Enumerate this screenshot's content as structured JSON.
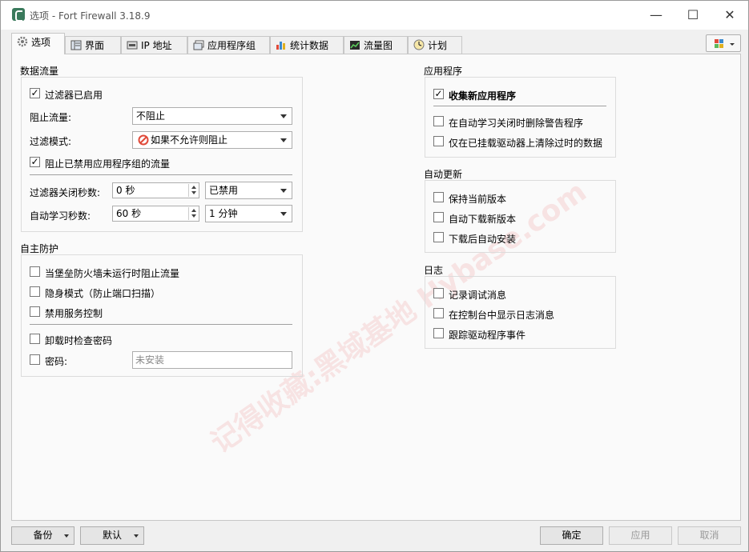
{
  "window": {
    "title": "选项 - Fort Firewall 3.18.9",
    "minimize": "—",
    "maximize": "☐",
    "close": "✕"
  },
  "tabs": [
    {
      "label": "选项",
      "icon": "gear-icon"
    },
    {
      "label": "界面",
      "icon": "interface-icon"
    },
    {
      "label": "IP 地址",
      "icon": "ip-address-icon"
    },
    {
      "label": "应用程序组",
      "icon": "app-group-icon"
    },
    {
      "label": "统计数据",
      "icon": "statistics-icon"
    },
    {
      "label": "流量图",
      "icon": "traffic-graph-icon"
    },
    {
      "label": "计划",
      "icon": "schedule-clock-icon"
    }
  ],
  "traffic": {
    "title": "数据流量",
    "filter_enabled": {
      "label": "过滤器已启用",
      "checked": true
    },
    "block_traffic": {
      "label": "阻止流量:",
      "value": "不阻止"
    },
    "filter_mode": {
      "label": "过滤模式:",
      "value": "如果不允许则阻止"
    },
    "block_disabled_groups": {
      "label": "阻止已禁用应用程序组的流量",
      "checked": true
    },
    "filter_off_seconds": {
      "label": "过滤器关闭秒数:",
      "value": "0 秒",
      "combo": "已禁用"
    },
    "autolearn_seconds": {
      "label": "自动学习秒数:",
      "value": "60 秒",
      "combo": "1 分钟"
    }
  },
  "protection": {
    "title": "自主防护",
    "block_when_not_running": {
      "label": "当堡垒防火墙未运行时阻止流量",
      "checked": false
    },
    "stealth_mode": {
      "label": "隐身模式（防止端口扫描）",
      "checked": false
    },
    "disable_service_control": {
      "label": "禁用服务控制",
      "checked": false
    },
    "check_password_on_uninstall": {
      "label": "卸载时检查密码",
      "checked": false
    },
    "password": {
      "label": "密码:",
      "placeholder": "未安装",
      "checked": false
    }
  },
  "programs": {
    "title": "应用程序",
    "collect_new": {
      "label": "收集新应用程序",
      "checked": true
    },
    "delete_alerts": {
      "label": "在自动学习关闭时删除警告程序",
      "checked": false
    },
    "purge_obsolete": {
      "label": "仅在已挂载驱动器上清除过时的数据",
      "checked": false
    }
  },
  "autoupdate": {
    "title": "自动更新",
    "keep_current": {
      "label": "保持当前版本",
      "checked": false
    },
    "auto_download": {
      "label": "自动下载新版本",
      "checked": false
    },
    "install_after": {
      "label": "下载后自动安装",
      "checked": false
    }
  },
  "logs": {
    "title": "日志",
    "log_debug": {
      "label": "记录调试消息",
      "checked": false
    },
    "log_console": {
      "label": "在控制台中显示日志消息",
      "checked": false
    },
    "trace_driver": {
      "label": "跟踪驱动程序事件",
      "checked": false
    }
  },
  "buttons": {
    "backup": "备份",
    "defaults": "默认",
    "ok": "确定",
    "apply": "应用",
    "cancel": "取消"
  },
  "watermark": "记得收藏:黑域基地 Hybase.com",
  "colors": {
    "accent_red": "#e04a3a",
    "window_bg": "#f0f0f0"
  }
}
